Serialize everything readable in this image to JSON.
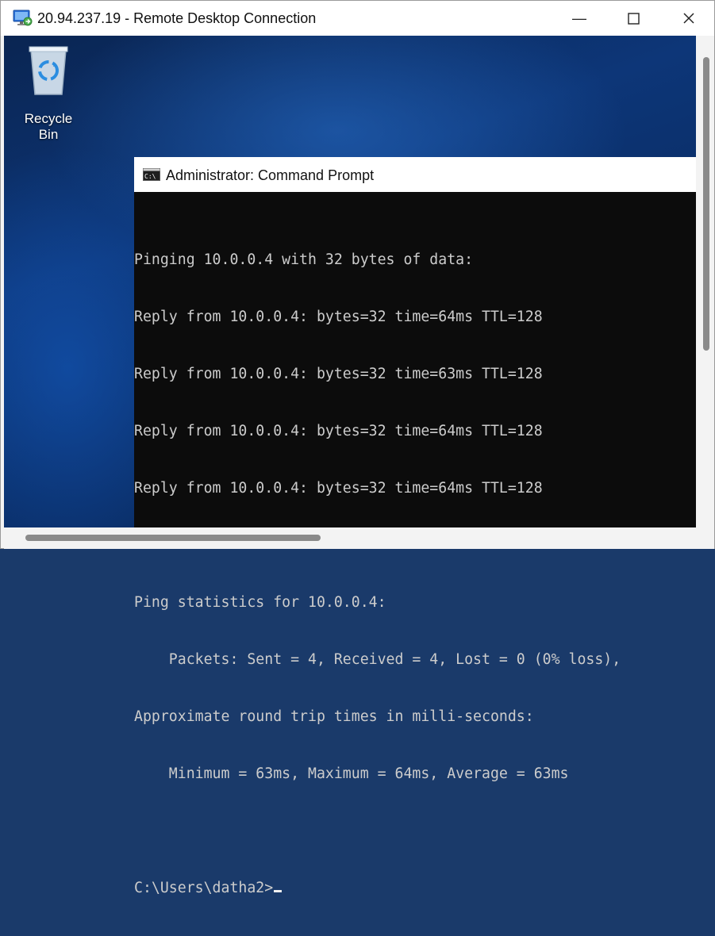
{
  "rdp_window": {
    "title": "20.94.237.19 - Remote Desktop Connection",
    "app_icon": "remote-desktop-icon",
    "minimize_glyph": "—",
    "maximize_glyph": "☐",
    "close_glyph": "✕"
  },
  "desktop": {
    "icons": [
      {
        "label": "Recycle Bin",
        "icon": "recycle-bin-icon"
      }
    ]
  },
  "cmd_window": {
    "title": "Administrator: Command Prompt",
    "icon": "command-prompt-icon",
    "output_lines": [
      "Pinging 10.0.0.4 with 32 bytes of data:",
      "Reply from 10.0.0.4: bytes=32 time=64ms TTL=128",
      "Reply from 10.0.0.4: bytes=32 time=63ms TTL=128",
      "Reply from 10.0.0.4: bytes=32 time=64ms TTL=128",
      "Reply from 10.0.0.4: bytes=32 time=64ms TTL=128",
      "",
      "Ping statistics for 10.0.0.4:",
      "    Packets: Sent = 4, Received = 4, Lost = 0 (0% loss),",
      "Approximate round trip times in milli-seconds:",
      "    Minimum = 63ms, Maximum = 64ms, Average = 63ms",
      ""
    ],
    "prompt": "C:\\Users\\datha2>"
  },
  "colors": {
    "console_background": "#0c0c0c",
    "console_text": "#cccccc",
    "titlebar": "#ffffff",
    "desktop_blue": "#0d3678"
  }
}
